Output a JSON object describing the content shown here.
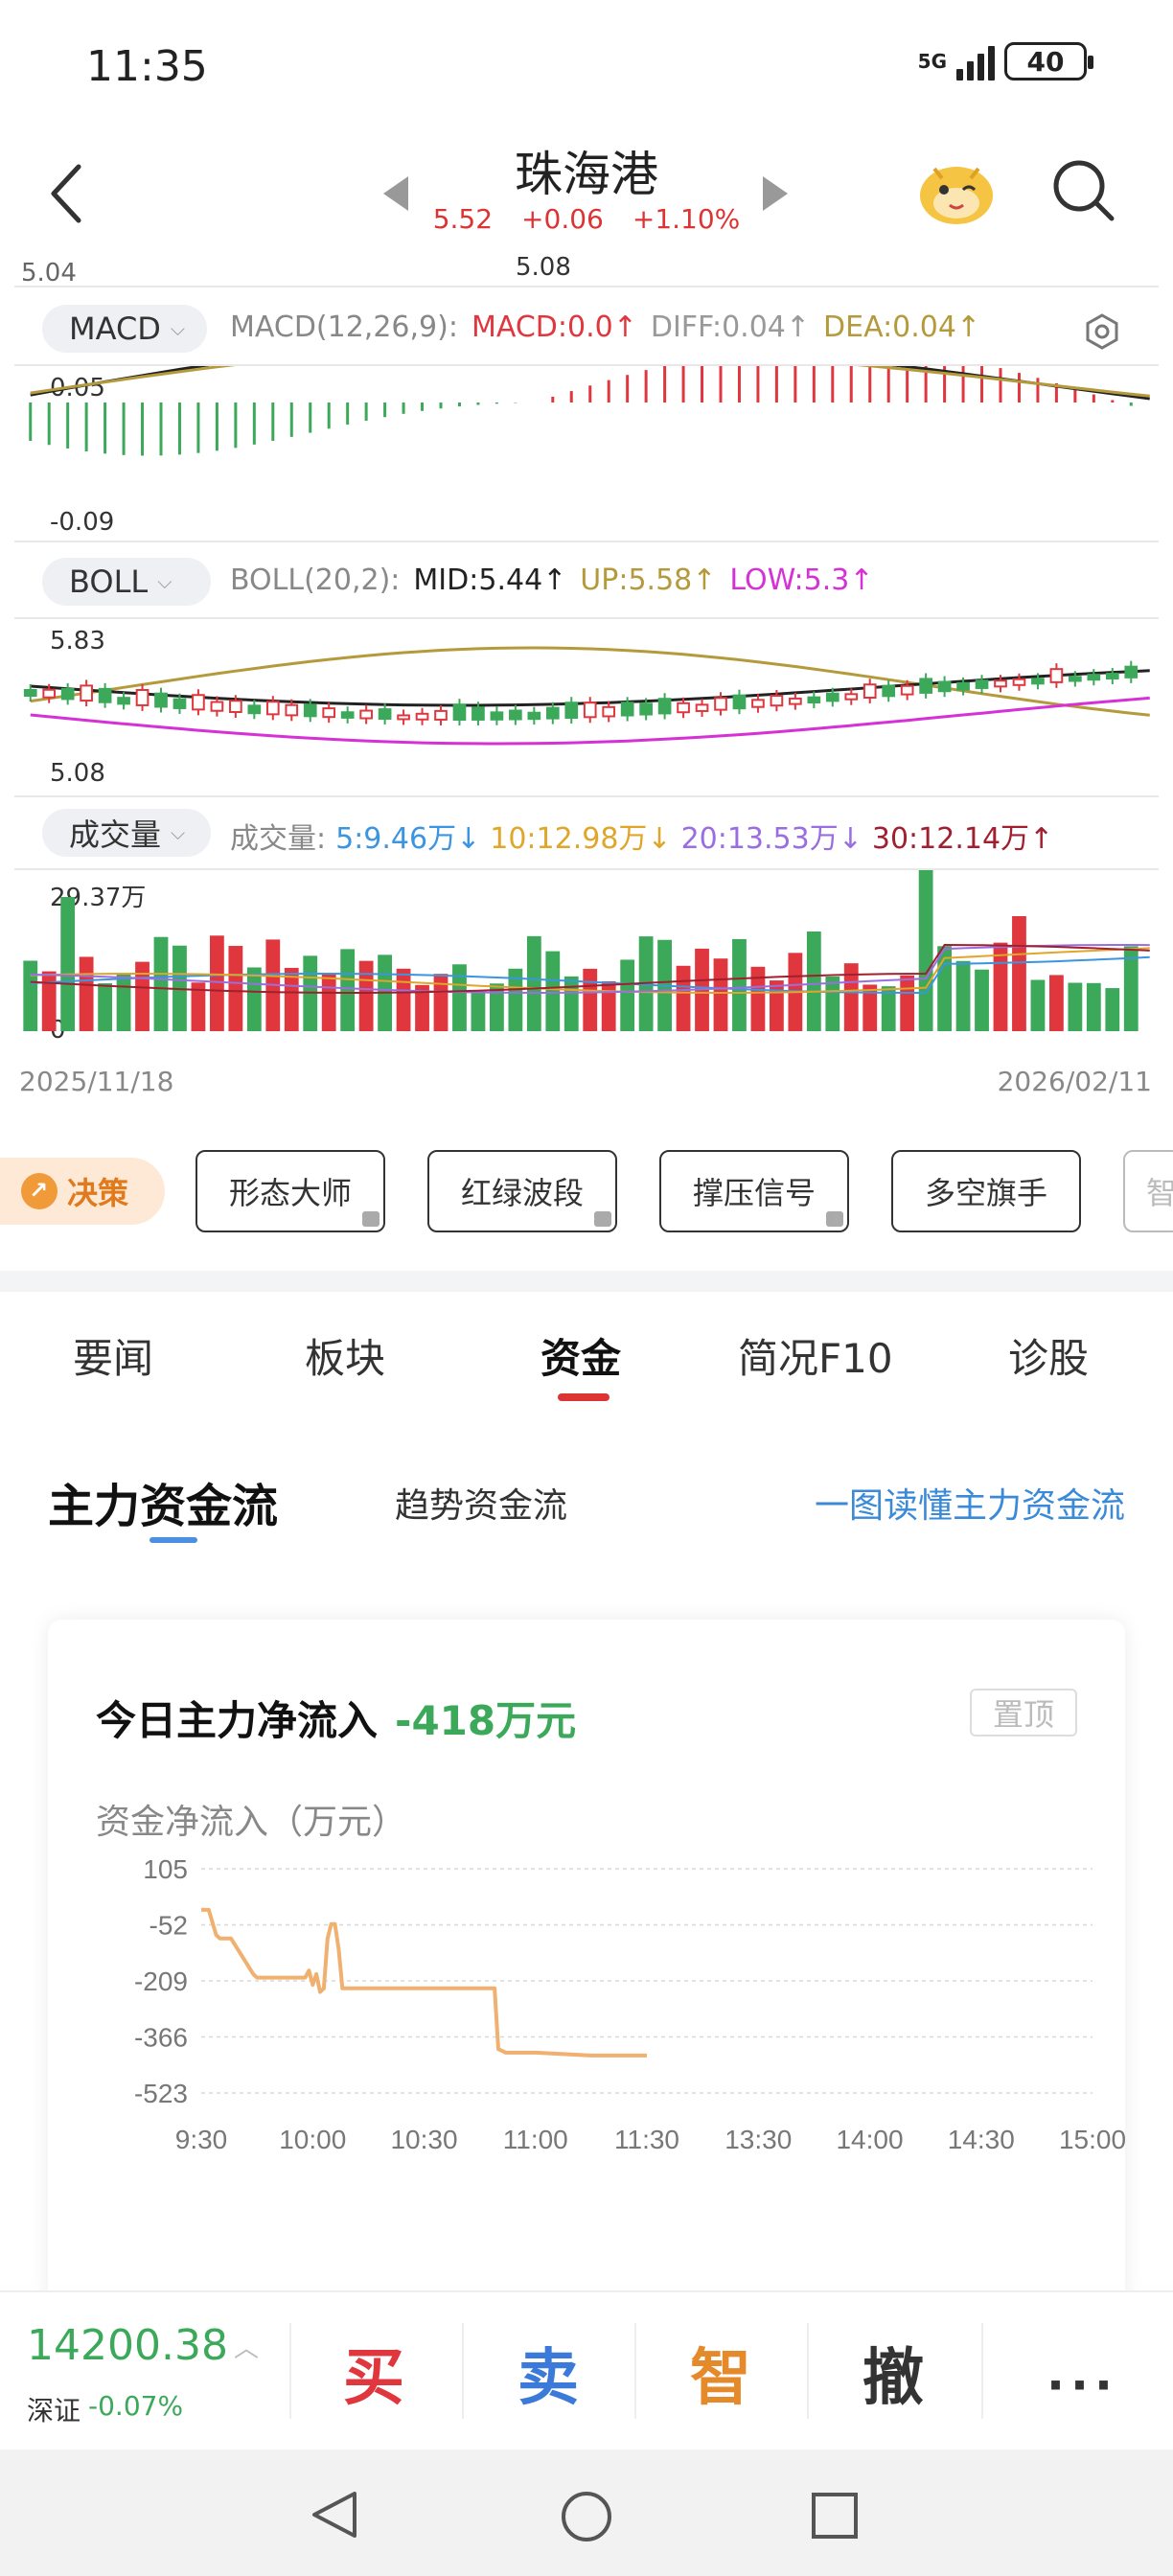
{
  "status": {
    "time": "11:35",
    "network": "5G",
    "battery": "40"
  },
  "header": {
    "title": "珠海港",
    "price": "5.52",
    "change": "+0.06",
    "change_pct": "+1.10%"
  },
  "chart": {
    "top_left_value": "5.04",
    "top_mid_value": "5.08",
    "macd": {
      "selector": "MACD",
      "params": "MACD(12,26,9):",
      "macd": "MACD:0.0↑",
      "diff": "DIFF:0.04↑",
      "dea": "DEA:0.04↑",
      "axis_top": "0.05",
      "axis_bottom": "-0.09"
    },
    "boll": {
      "selector": "BOLL",
      "params": "BOLL(20,2):",
      "mid": "MID:5.44↑",
      "up": "UP:5.58↑",
      "low": "LOW:5.3↑",
      "axis_top": "5.83",
      "axis_bottom": "5.08"
    },
    "volume": {
      "selector": "成交量",
      "label": "成交量:",
      "ma5": "5:9.46万↓",
      "ma10": "10:12.98万↓",
      "ma20": "20:13.53万↓",
      "ma30": "30:12.14万↑",
      "axis_top": "29.37万",
      "axis_bottom": "0"
    },
    "date_start": "2025/11/18",
    "date_end": "2026/02/11",
    "colors": {
      "up": "#e0373f",
      "down": "#3ca85a",
      "diff": "#222222",
      "dea": "#b59a3c",
      "low": "#d631d6",
      "ma5": "#3c95e0",
      "ma10": "#e0a62a",
      "ma20": "#9a6ee0",
      "ma30": "#a02030"
    }
  },
  "tools": {
    "decision": "决策",
    "chips": [
      "形态大师",
      "红绿波段",
      "撑压信号",
      "多空旗手",
      "智"
    ]
  },
  "tabs": [
    "要闻",
    "板块",
    "资金",
    "简况F10",
    "诊股"
  ],
  "active_tab": "资金",
  "section": {
    "title": "主力资金流",
    "subtab": "趋势资金流",
    "link": "一图读懂主力资金流"
  },
  "card": {
    "title": "今日主力净流入",
    "value": "-418万元",
    "pin": "置顶",
    "chart_label": "资金净流入（万元）"
  },
  "chart_data": {
    "type": "line",
    "title": "",
    "xlabel": "",
    "ylabel": "资金净流入（万元）",
    "y_ticks": [
      "105",
      "-52",
      "-209",
      "-366",
      "-523"
    ],
    "x_ticks": [
      "9:30",
      "10:00",
      "10:30",
      "11:00",
      "11:30",
      "13:30",
      "14:00",
      "14:30",
      "15:00"
    ],
    "ylim": [
      -523,
      105
    ],
    "grid": true,
    "series": [
      {
        "color": "#f0b070",
        "x": [
          "9:30",
          "9:32",
          "9:34",
          "9:35",
          "9:38",
          "9:44",
          "9:45",
          "9:58",
          "9:59",
          "10:00",
          "10:01",
          "10:02",
          "10:03",
          "10:04",
          "10:05",
          "10:06",
          "10:07",
          "10:08",
          "10:09",
          "10:15",
          "10:30",
          "10:45",
          "10:49",
          "10:50",
          "10:52",
          "11:00",
          "11:15",
          "11:30"
        ],
        "y": [
          -10,
          -10,
          -80,
          -90,
          -90,
          -190,
          -200,
          -200,
          -180,
          -220,
          -190,
          -240,
          -230,
          -90,
          -50,
          -50,
          -120,
          -230,
          -230,
          -230,
          -230,
          -230,
          -230,
          -400,
          -410,
          -410,
          -418,
          -418
        ]
      }
    ]
  },
  "bottom": {
    "index_value": "14200.38",
    "index_name": "深证",
    "index_change": "-0.07%",
    "buy": "买",
    "sell": "卖",
    "smart": "智",
    "cancel": "撤",
    "more": "···"
  }
}
